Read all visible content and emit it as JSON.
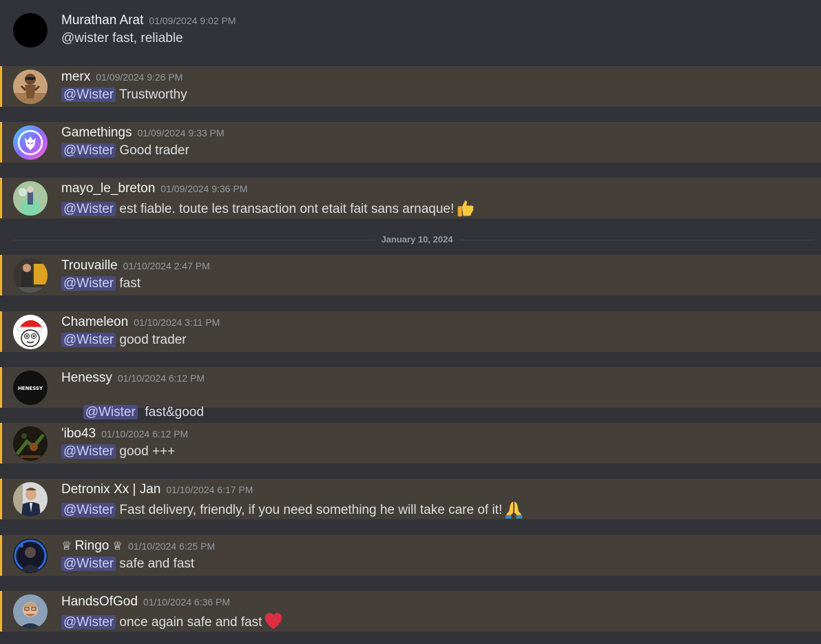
{
  "mention_label": "@Wister",
  "date_divider": "January 10, 2024",
  "colors": {
    "background": "#313338",
    "mention_highlight": "#444039",
    "mention_bar": "#f0b232",
    "ping_bg": "#4a4c7e",
    "ping_text": "#c9cdfb"
  },
  "messages": [
    {
      "author": "Murathan Arat",
      "timestamp": "01/09/2024 9:02 PM",
      "text": "@wister fast, reliable",
      "mention": false
    },
    {
      "author": "merx",
      "timestamp": "01/09/2024 9:26 PM",
      "text": "Trustworthy",
      "mention": true
    },
    {
      "author": "Gamethings",
      "timestamp": "01/09/2024 9:33 PM",
      "text": "Good trader",
      "mention": true
    },
    {
      "author": "mayo_le_breton",
      "timestamp": "01/09/2024 9:36 PM",
      "text": "est fiable. toute les transaction ont etait fait sans arnaque!",
      "emoji": "thumbs-up-emoji",
      "mention": true
    },
    {
      "author": "Trouvaille",
      "timestamp": "01/10/2024 2:47 PM",
      "text": "fast",
      "mention": true
    },
    {
      "author": "Chameleon",
      "timestamp": "01/10/2024 3:11 PM",
      "text": "good trader",
      "mention": true
    },
    {
      "author": "Henessy",
      "timestamp": "01/10/2024 6:12 PM",
      "text": " fast&good",
      "avatar_text": "HENESSY",
      "mention": true
    },
    {
      "author": "'ibo43",
      "timestamp": "01/10/2024 6:12 PM",
      "text": "good +++",
      "mention": true
    },
    {
      "author": "Detronix Xx | Jan",
      "timestamp": "01/10/2024 6:17 PM",
      "text": "Fast delivery, friendly, if you need something he will take care of it!",
      "emoji": "folded-hands-emoji",
      "mention": true
    },
    {
      "author": "Ringo",
      "author_prefix": "♕",
      "author_suffix": "♕",
      "timestamp": "01/10/2024 6:25 PM",
      "text": "safe and fast",
      "mention": true
    },
    {
      "author": "HandsOfGod",
      "timestamp": "01/10/2024 6:36 PM",
      "text": "once again safe and fast",
      "emoji": "red-heart-emoji",
      "mention": true
    }
  ]
}
